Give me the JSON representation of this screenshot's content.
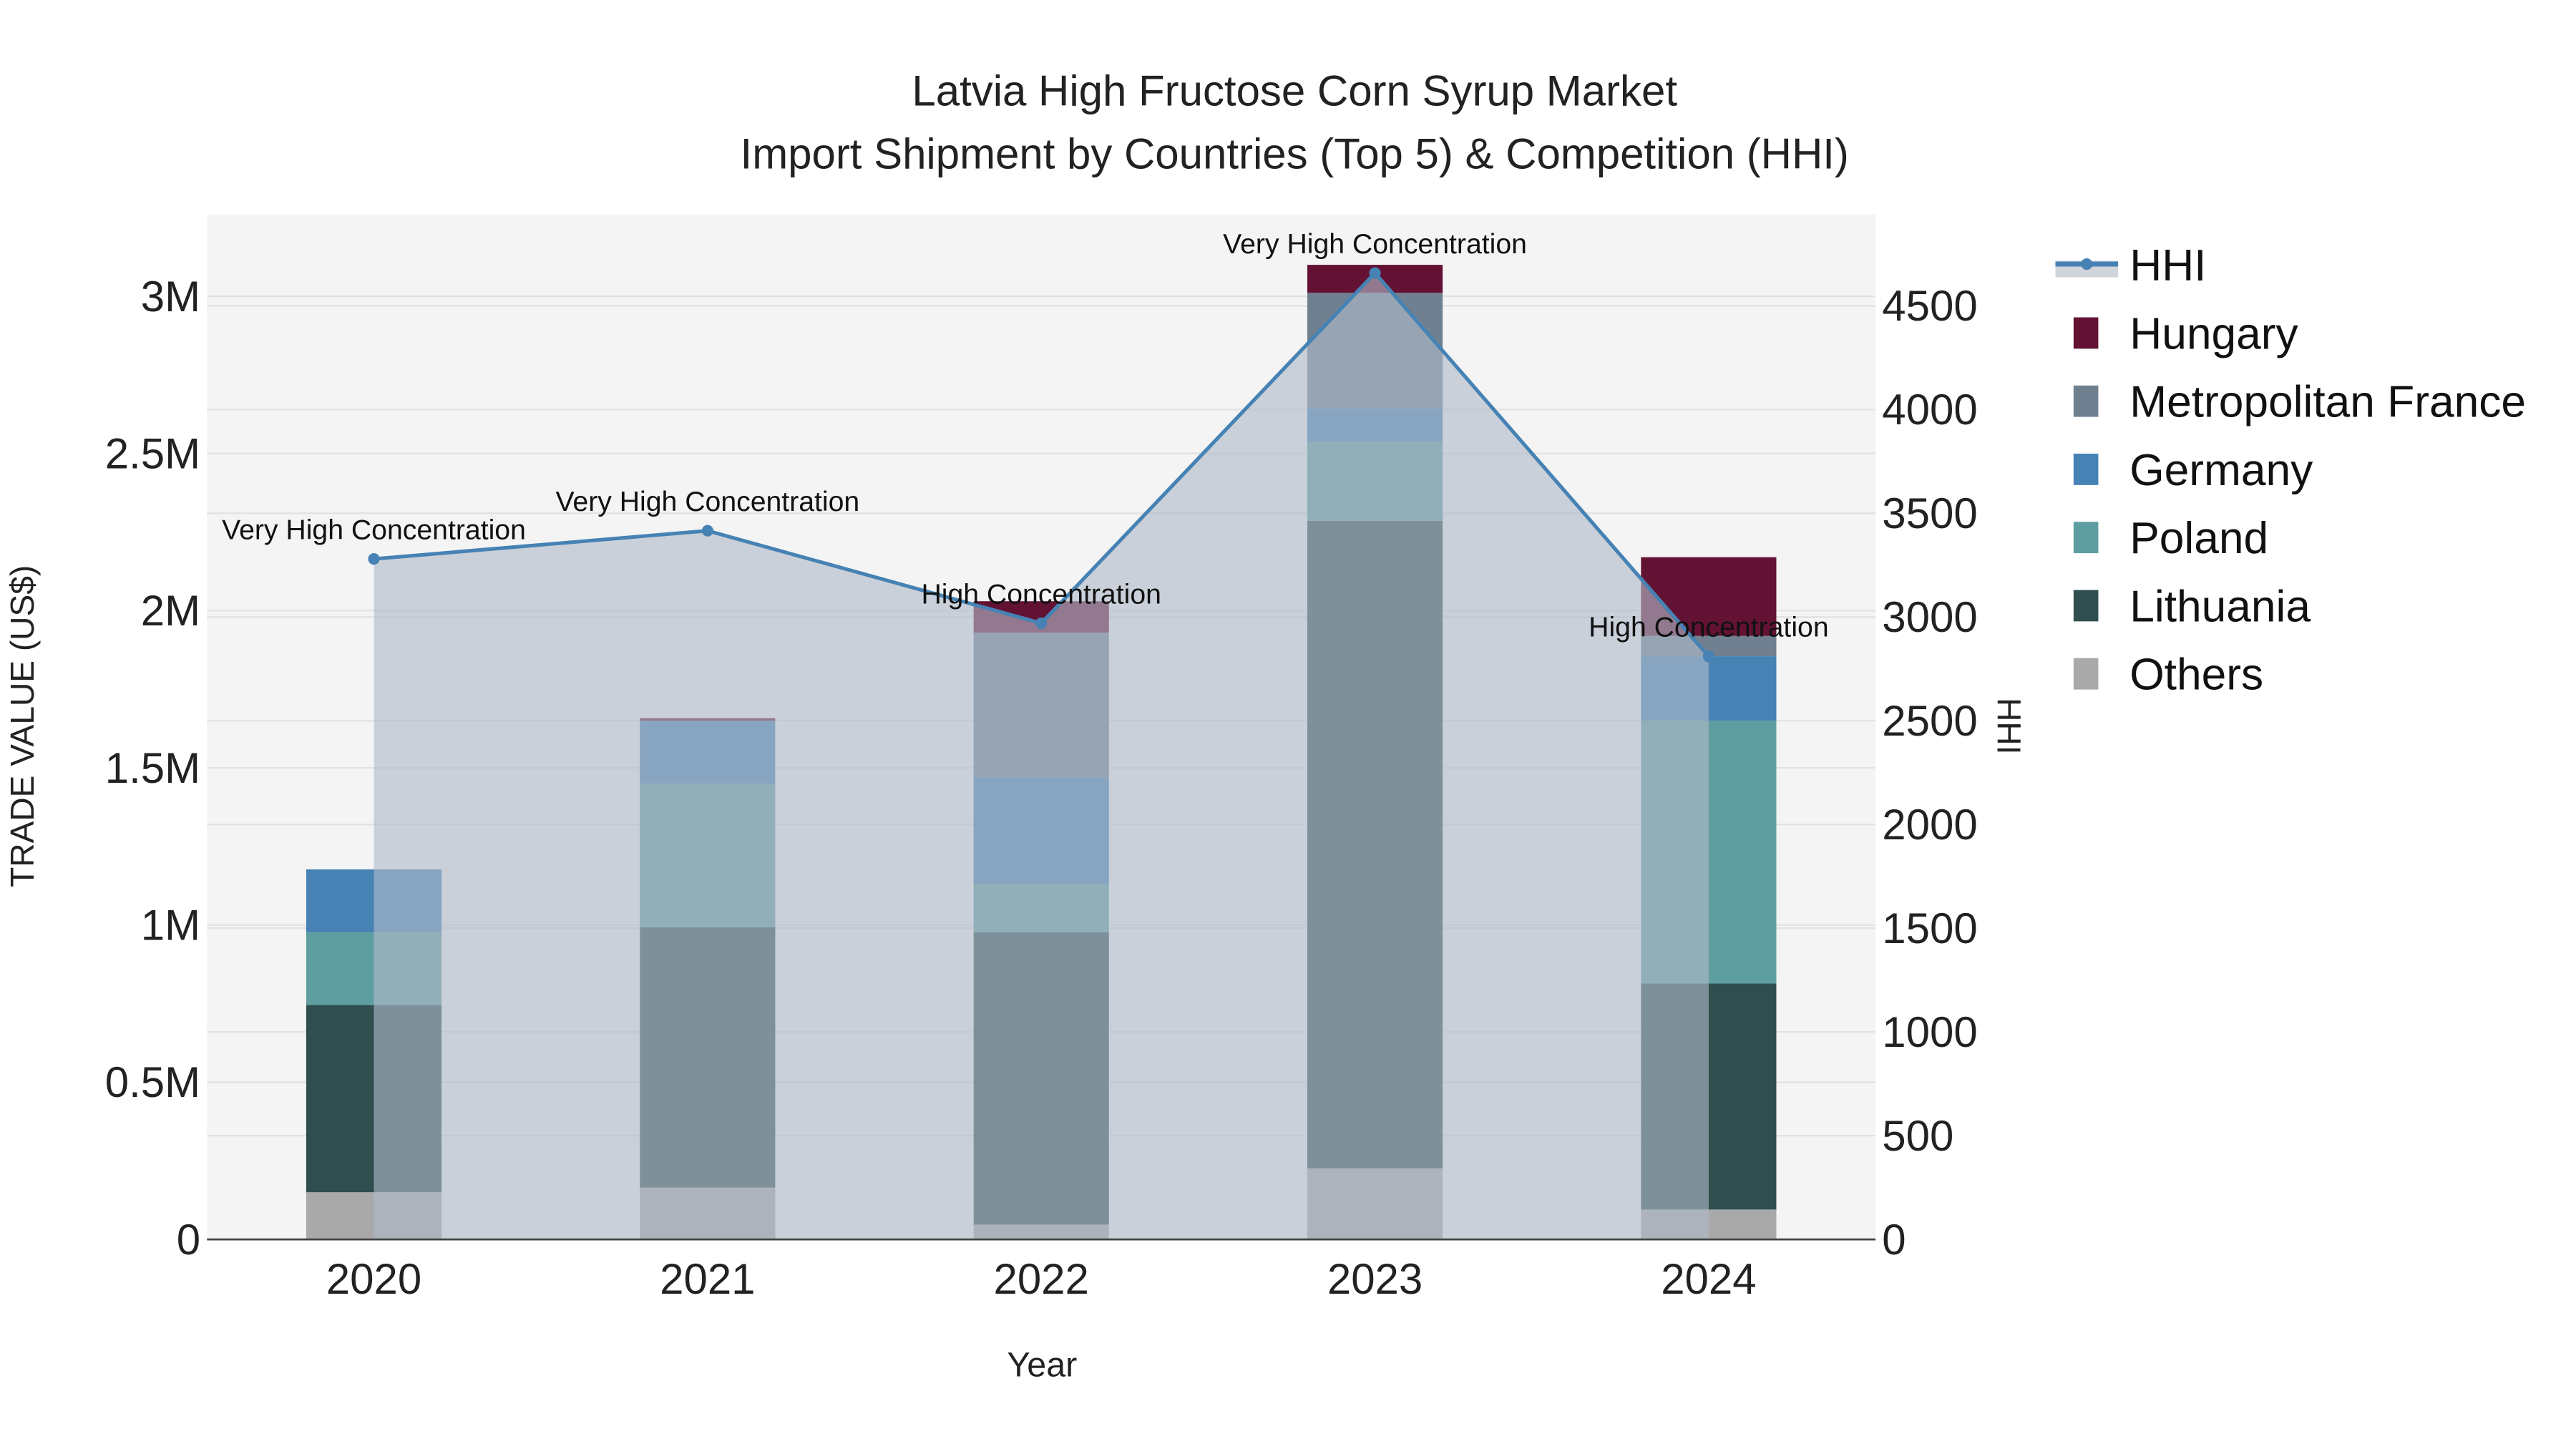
{
  "chart_data": {
    "type": "bar",
    "title_line1": "Latvia High Fructose Corn Syrup Market",
    "title_line2": "Import Shipment by Countries (Top 5) & Competition (HHI)",
    "xlabel": "Year",
    "ylabel": "TRADE VALUE (US$)",
    "y2label": "HHI",
    "categories": [
      "2020",
      "2021",
      "2022",
      "2023",
      "2024"
    ],
    "ylim": [
      0,
      3260000
    ],
    "y2lim": [
      0,
      4940
    ],
    "yticks": [
      {
        "v": 0,
        "label": "0"
      },
      {
        "v": 500000,
        "label": "0.5M"
      },
      {
        "v": 1000000,
        "label": "1M"
      },
      {
        "v": 1500000,
        "label": "1.5M"
      },
      {
        "v": 2000000,
        "label": "2M"
      },
      {
        "v": 2500000,
        "label": "2.5M"
      },
      {
        "v": 3000000,
        "label": "3M"
      }
    ],
    "y2ticks": [
      0,
      500,
      1000,
      1500,
      2000,
      2500,
      3000,
      3500,
      4000,
      4500
    ],
    "series": [
      {
        "name": "Others",
        "color": "#A9A9A9",
        "values": [
          150000,
          165000,
          47000,
          226000,
          95000
        ]
      },
      {
        "name": "Lithuania",
        "color": "#2F4F4F",
        "values": [
          596000,
          828000,
          930000,
          2060000,
          719000
        ]
      },
      {
        "name": "Poland",
        "color": "#5F9EA0",
        "values": [
          231000,
          457000,
          153000,
          252000,
          836000
        ]
      },
      {
        "name": "Germany",
        "color": "#4682B4",
        "values": [
          200000,
          200000,
          340000,
          105000,
          205000
        ]
      },
      {
        "name": "Metropolitan France",
        "color": "#708090",
        "values": [
          0,
          0,
          460000,
          368000,
          65000
        ]
      },
      {
        "name": "Hungary",
        "color": "#631234",
        "values": [
          0,
          8000,
          100000,
          89000,
          250000
        ]
      }
    ],
    "hhi": {
      "name": "HHI",
      "color": "#4682B4",
      "values": [
        3280,
        3416,
        2970,
        4658,
        2810
      ]
    },
    "annotations": [
      "Very High Concentration",
      "Very High Concentration",
      "High Concentration",
      "Very High Concentration",
      "High Concentration"
    ],
    "legend_order": [
      "HHI",
      "Hungary",
      "Metropolitan France",
      "Germany",
      "Poland",
      "Lithuania",
      "Others"
    ],
    "legend_position": "right",
    "grid": true
  }
}
